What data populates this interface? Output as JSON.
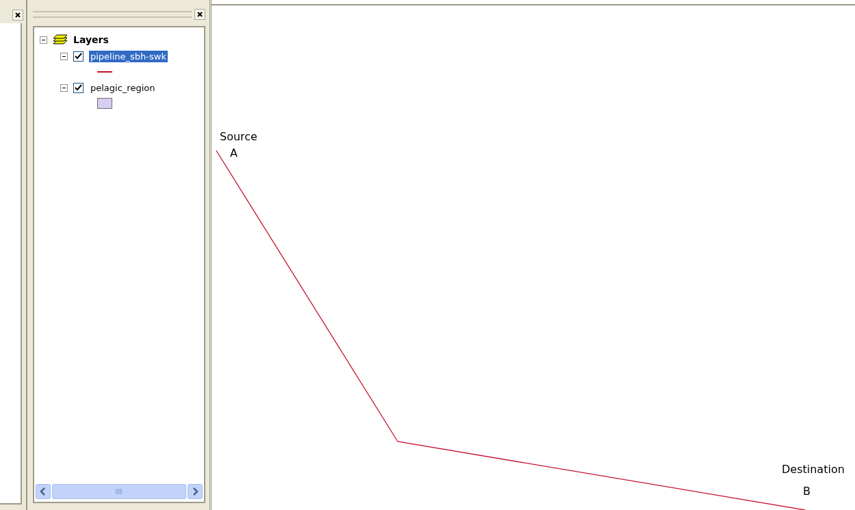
{
  "toc": {
    "root": {
      "label": "Layers",
      "expanded": true,
      "children": [
        {
          "label": "pipeline_sbh-swk",
          "checked": true,
          "expanded": true,
          "selected": true,
          "symbol": {
            "kind": "line",
            "color": "#c8102e"
          }
        },
        {
          "label": "pelagic_region",
          "checked": true,
          "expanded": true,
          "selected": false,
          "symbol": {
            "kind": "fill",
            "color": "#d6cdf0"
          }
        }
      ]
    }
  },
  "map": {
    "labels": [
      {
        "text": "Source"
      },
      {
        "text": "A"
      },
      {
        "text": "Destination"
      },
      {
        "text": "B"
      }
    ]
  }
}
